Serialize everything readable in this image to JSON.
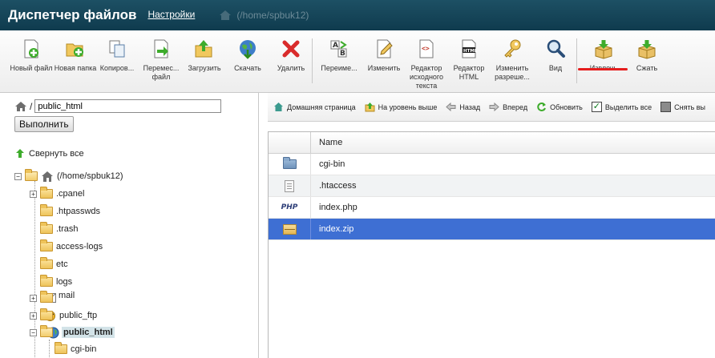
{
  "header": {
    "title": "Диспетчер файлов",
    "settings_link": "Настройки",
    "ghost_text": "(/home/spbuk12)"
  },
  "toolbar": {
    "buttons": [
      {
        "label": "Новый файл",
        "icon": "new-file-icon"
      },
      {
        "label": "Новая папка",
        "icon": "new-folder-icon"
      },
      {
        "label": "Копиров...",
        "icon": "copy-icon"
      },
      {
        "label": "Перемес... файл",
        "icon": "move-file-icon"
      },
      {
        "label": "Загрузить",
        "icon": "upload-icon"
      },
      {
        "label": "Скачать",
        "icon": "download-icon"
      },
      {
        "label": "Удалить",
        "icon": "delete-icon"
      },
      {
        "label": "Переиме...",
        "icon": "rename-icon"
      },
      {
        "label": "Изменить",
        "icon": "edit-icon"
      },
      {
        "label": "Редактор исходного текста",
        "icon": "code-editor-icon"
      },
      {
        "label": "Редактор HTML",
        "icon": "html-editor-icon"
      },
      {
        "label": "Изменить разреше...",
        "icon": "permissions-icon"
      },
      {
        "label": "Вид",
        "icon": "view-icon"
      },
      {
        "label": "Извлечь",
        "icon": "extract-icon"
      },
      {
        "label": "Сжать",
        "icon": "compress-icon"
      }
    ],
    "highlight_color": "#e51d1d"
  },
  "left": {
    "path_value": "public_html",
    "go_button": "Выполнить",
    "collapse_all": "Свернуть все",
    "tree": {
      "root": "(/home/spbuk12)",
      "items": [
        {
          "label": ".cpanel",
          "expandable": true
        },
        {
          "label": ".htpasswds",
          "expandable": false
        },
        {
          "label": ".trash",
          "expandable": false
        },
        {
          "label": "access-logs",
          "expandable": false
        },
        {
          "label": "etc",
          "expandable": false
        },
        {
          "label": "logs",
          "expandable": false
        },
        {
          "label": "mail",
          "expandable": true
        },
        {
          "label": "public_ftp",
          "expandable": true
        },
        {
          "label": "public_html",
          "expandable": true,
          "selected": true
        }
      ],
      "child": "cgi-bin"
    }
  },
  "nav": {
    "items": [
      {
        "label": "Домашняя страница",
        "icon": "home-icon"
      },
      {
        "label": "На уровень выше",
        "icon": "up-level-icon"
      },
      {
        "label": "Назад",
        "icon": "back-arrow-icon"
      },
      {
        "label": "Вперед",
        "icon": "forward-arrow-icon"
      },
      {
        "label": "Обновить",
        "icon": "refresh-icon"
      },
      {
        "label": "Выделить все",
        "icon": "select-all-checkbox"
      },
      {
        "label": "Снять вы",
        "icon": "unselect-all-checkbox"
      }
    ]
  },
  "files": {
    "column_name": "Name",
    "rows": [
      {
        "name": "cgi-bin",
        "icon": "folder-icon"
      },
      {
        "name": ".htaccess",
        "icon": "document-icon"
      },
      {
        "name": "index.php",
        "icon": "php-file-icon",
        "icon_text": "PHP"
      },
      {
        "name": "index.zip",
        "icon": "zip-archive-icon",
        "selected": true
      }
    ],
    "selected_color": "#3e6fd3"
  }
}
